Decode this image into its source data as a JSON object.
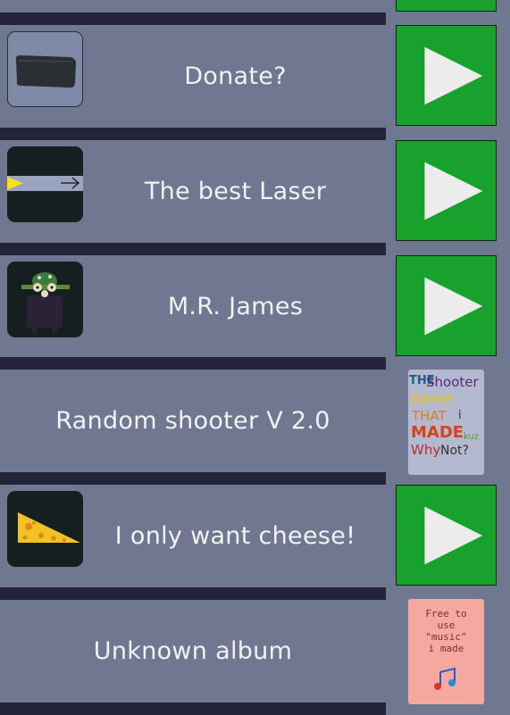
{
  "songs": [
    {
      "title": "Donate?",
      "thumb": "black-rock-image",
      "action": "play-icon"
    },
    {
      "title": "The best Laser",
      "thumb": "laser-image",
      "action": "play-icon"
    },
    {
      "title": "M.R. James",
      "thumb": "creature-image",
      "action": "play-icon"
    },
    {
      "title": "Random shooter V 2.0",
      "thumb": null,
      "action": "album-cover"
    },
    {
      "title": "I only want cheese!",
      "thumb": "cheese-image",
      "action": "play-icon"
    },
    {
      "title": "Unknown album",
      "thumb": null,
      "action": "album-cover"
    }
  ],
  "covers": {
    "shooter": {
      "line1a": "THE",
      "line1b": "Shooter",
      "line2": "Game",
      "line3a": "THAT",
      "line3b": "i",
      "line4a": "MADE",
      "line4b": "kuz",
      "line5a": "Why",
      "line5b": "Not?"
    },
    "free": {
      "line1": "Free to",
      "line2": "use",
      "line3": "\"music\"",
      "line4": "i made"
    }
  },
  "colors": {
    "background": "#6f7890",
    "divider": "#23233a",
    "play_button": "#18a22d"
  }
}
